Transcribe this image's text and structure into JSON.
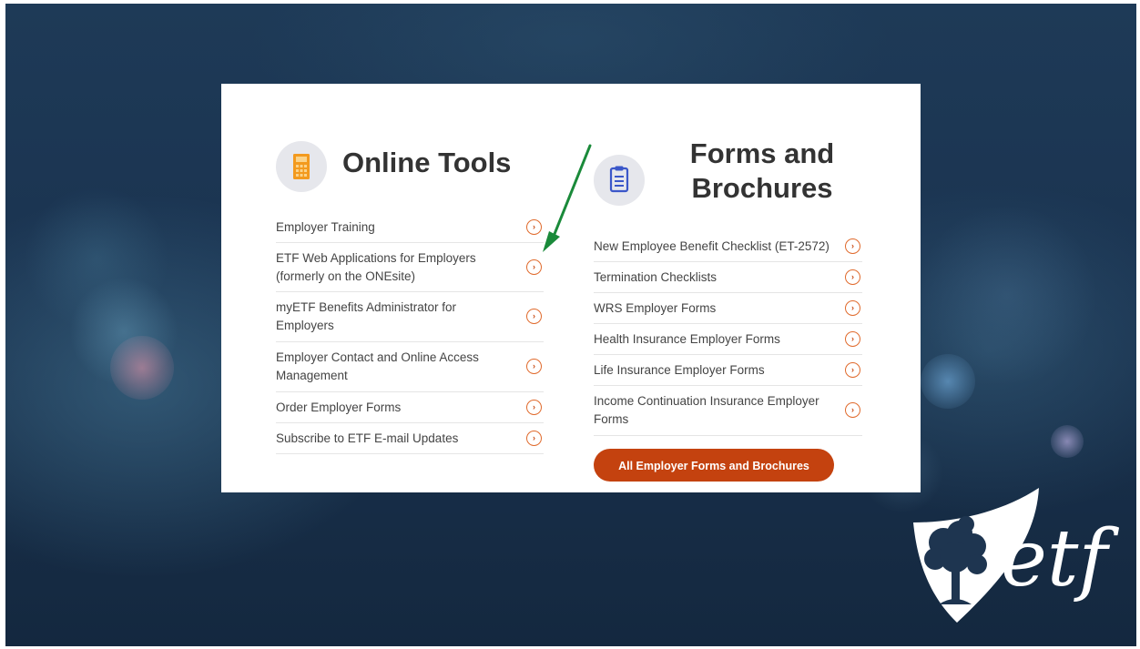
{
  "online_tools": {
    "title": "Online Tools",
    "icon": "calculator-icon",
    "links": [
      {
        "label": "Employer Training"
      },
      {
        "label": "ETF Web Applications for Employers (formerly on the ONEsite)"
      },
      {
        "label": "myETF Benefits Administrator for Employers"
      },
      {
        "label": "Employer Contact and Online Access Management"
      },
      {
        "label": "Order Employer Forms"
      },
      {
        "label": "Subscribe to ETF E-mail Updates"
      }
    ]
  },
  "forms": {
    "title": "Forms and Brochures",
    "icon": "clipboard-icon",
    "links": [
      {
        "label": "New Employee Benefit Checklist (ET-2572)"
      },
      {
        "label": "Termination Checklists"
      },
      {
        "label": "WRS Employer Forms"
      },
      {
        "label": "Health Insurance Employer Forms"
      },
      {
        "label": "Life Insurance Employer Forms"
      },
      {
        "label": "Income Continuation Insurance Employer Forms"
      }
    ],
    "button_label": "All Employer Forms and Brochures"
  },
  "logo": {
    "text": "etf"
  },
  "colors": {
    "accent": "#c4420f",
    "chevron": "#e06a2c",
    "annotation_arrow": "#1a8a3a",
    "calculator_icon": "#f39a1e",
    "clipboard_icon": "#3b57c9"
  },
  "chevron_glyph": "›"
}
